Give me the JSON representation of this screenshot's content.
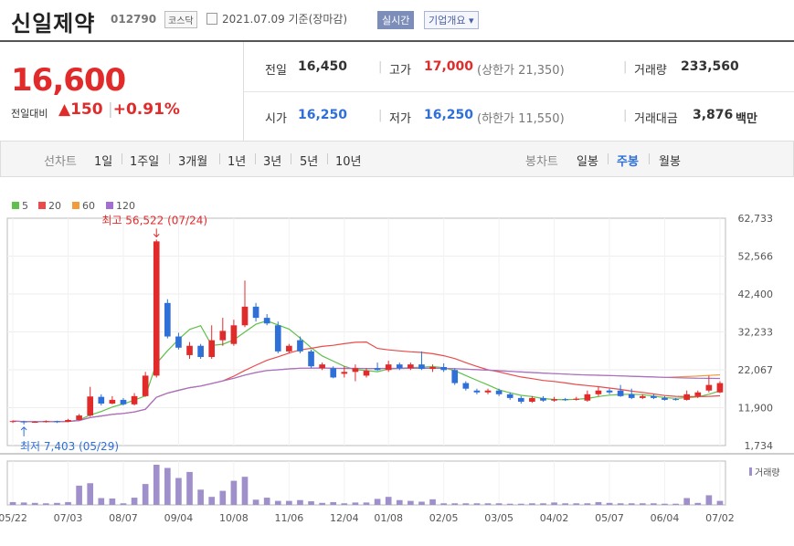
{
  "header": {
    "name": "신일제약",
    "code": "012790",
    "market": "코스닥",
    "date": "2021.07.09 기준(장마감)",
    "realtime": "실시간",
    "company": "기업개요 ▾"
  },
  "quote": {
    "current": "16,600",
    "diff_label": "전일대비",
    "diff_value": "▲150",
    "diff_rate": "+0.91%",
    "prev_label": "전일",
    "prev": "16,450",
    "high_label": "고가",
    "high": "17,000",
    "upper": "(상한가 21,350)",
    "volume_label": "거래량",
    "volume": "233,560",
    "open_label": "시가",
    "open": "16,250",
    "low_label": "저가",
    "low": "16,250",
    "lower": "(하한가 11,550)",
    "amount_label": "거래대금",
    "amount": "3,876",
    "amount_unit": "백만"
  },
  "tabs": {
    "line_label": "선차트",
    "line_items": [
      "1일",
      "1주일",
      "3개월",
      "1년",
      "3년",
      "5년",
      "10년"
    ],
    "candle_label": "봉차트",
    "candle_items": [
      "일봉",
      "주봉",
      "월봉"
    ],
    "candle_active": "주봉"
  },
  "colors": {
    "up": "#e12b2b",
    "down": "#2e6fd8",
    "ma5": "#5fc04a",
    "ma20": "#e94b4b",
    "ma60": "#f39a3c",
    "ma120": "#a36fd1",
    "volume": "#9f8fcb"
  },
  "chart_data": {
    "type": "candlestick",
    "legend": [
      "5",
      "20",
      "60",
      "120"
    ],
    "ylim": [
      1734,
      62733
    ],
    "yticks": [
      "62,733",
      "52,566",
      "42,400",
      "32,233",
      "22,067",
      "11,900",
      "1,734"
    ],
    "xticks": [
      "05/22",
      "07/03",
      "08/07",
      "09/04",
      "10/08",
      "11/06",
      "12/04",
      "01/08",
      "02/05",
      "03/05",
      "04/02",
      "05/07",
      "06/04",
      "07/02"
    ],
    "high_annotation": "최고 56,522 (07/24)",
    "low_annotation": "최저 7,403 (05/29)",
    "volume_label": "거래량",
    "candles": [
      [
        8300,
        8300,
        7800,
        8500
      ],
      [
        8200,
        8050,
        7403,
        8400
      ],
      [
        8000,
        8100,
        7900,
        8300
      ],
      [
        8100,
        8300,
        7900,
        8500
      ],
      [
        8300,
        8000,
        7800,
        8400
      ],
      [
        8100,
        8600,
        8000,
        8900
      ],
      [
        8600,
        9800,
        8500,
        10200
      ],
      [
        9800,
        14900,
        9500,
        17500
      ],
      [
        14800,
        13000,
        12500,
        15500
      ],
      [
        13000,
        14000,
        12800,
        15000
      ],
      [
        14000,
        12800,
        12500,
        14500
      ],
      [
        12800,
        15000,
        12500,
        15800
      ],
      [
        15000,
        20500,
        14800,
        21500
      ],
      [
        20500,
        56522,
        20000,
        57000
      ],
      [
        40000,
        31000,
        30500,
        41000
      ],
      [
        31000,
        28000,
        27500,
        32000
      ],
      [
        26000,
        28500,
        25000,
        29500
      ],
      [
        28500,
        25500,
        25000,
        29000
      ],
      [
        25500,
        30000,
        25000,
        34000
      ],
      [
        30000,
        32500,
        28500,
        36000
      ],
      [
        29000,
        34000,
        28500,
        35500
      ],
      [
        34000,
        39000,
        33500,
        46000
      ],
      [
        39000,
        36000,
        35000,
        40000
      ],
      [
        36000,
        34500,
        34000,
        37000
      ],
      [
        34000,
        27000,
        26500,
        35000
      ],
      [
        27000,
        28500,
        26500,
        29000
      ],
      [
        30000,
        27000,
        26500,
        31000
      ],
      [
        27000,
        23000,
        22500,
        27500
      ],
      [
        22500,
        23500,
        22000,
        24000
      ],
      [
        22500,
        20000,
        19800,
        23000
      ],
      [
        21000,
        21500,
        20000,
        23000
      ],
      [
        21500,
        22500,
        19000,
        23500
      ],
      [
        20500,
        21800,
        20000,
        22500
      ],
      [
        22500,
        22000,
        21800,
        24000
      ],
      [
        22000,
        23500,
        21500,
        24500
      ],
      [
        23500,
        22500,
        22000,
        24000
      ],
      [
        22500,
        23500,
        22000,
        24000
      ],
      [
        23500,
        22300,
        22000,
        27000
      ],
      [
        22300,
        22800,
        21500,
        23500
      ],
      [
        22800,
        22000,
        21500,
        23800
      ],
      [
        22000,
        18500,
        18000,
        22500
      ],
      [
        18500,
        17000,
        16500,
        19000
      ],
      [
        16500,
        16000,
        15500,
        17000
      ],
      [
        16000,
        16500,
        15500,
        17000
      ],
      [
        16500,
        15500,
        15000,
        17000
      ],
      [
        15500,
        14500,
        14000,
        16000
      ],
      [
        14500,
        13500,
        13000,
        15000
      ],
      [
        13500,
        14500,
        13200,
        15000
      ],
      [
        14500,
        13800,
        13500,
        15000
      ],
      [
        13800,
        14200,
        13500,
        14800
      ],
      [
        14200,
        14000,
        13700,
        14500
      ],
      [
        14000,
        14300,
        13800,
        14800
      ],
      [
        13800,
        15500,
        13500,
        16500
      ],
      [
        15500,
        16500,
        15000,
        17500
      ],
      [
        16500,
        16000,
        15500,
        17000
      ],
      [
        16500,
        15000,
        14800,
        18000
      ],
      [
        15500,
        14500,
        14200,
        17000
      ],
      [
        14500,
        15000,
        14200,
        15500
      ],
      [
        15000,
        14500,
        14200,
        15500
      ],
      [
        14500,
        14000,
        13800,
        15000
      ],
      [
        14200,
        14000,
        13800,
        14500
      ],
      [
        14000,
        15500,
        13800,
        16500
      ],
      [
        15000,
        16000,
        14500,
        16500
      ],
      [
        16500,
        18000,
        16000,
        20500
      ],
      [
        16000,
        18500,
        15800,
        19000
      ]
    ],
    "volume_rel": [
      0.07,
      0.06,
      0.05,
      0.04,
      0.05,
      0.07,
      0.48,
      0.54,
      0.17,
      0.16,
      0.04,
      0.18,
      0.52,
      1.0,
      0.92,
      0.67,
      0.82,
      0.38,
      0.2,
      0.35,
      0.6,
      0.7,
      0.13,
      0.18,
      0.1,
      0.1,
      0.12,
      0.09,
      0.05,
      0.07,
      0.04,
      0.06,
      0.06,
      0.15,
      0.2,
      0.12,
      0.1,
      0.08,
      0.14,
      0.04,
      0.04,
      0.04,
      0.04,
      0.04,
      0.04,
      0.03,
      0.03,
      0.04,
      0.04,
      0.06,
      0.04,
      0.04,
      0.04,
      0.07,
      0.05,
      0.04,
      0.04,
      0.04,
      0.04,
      0.03,
      0.03,
      0.17,
      0.05,
      0.24,
      0.1
    ]
  }
}
